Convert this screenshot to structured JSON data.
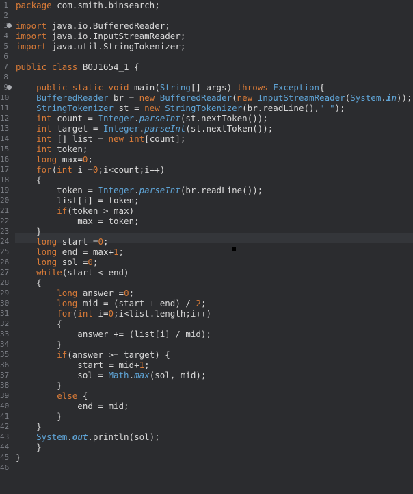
{
  "editor": {
    "language": "java",
    "cursor_line": 24,
    "lines": [
      {
        "n": "1",
        "text": "package com.smith.binsearch;"
      },
      {
        "n": "2",
        "text": ""
      },
      {
        "n": "3",
        "text": "import java.io.BufferedReader;",
        "fold": true
      },
      {
        "n": "4",
        "text": "import java.io.InputStreamReader;"
      },
      {
        "n": "5",
        "text": "import java.util.StringTokenizer;"
      },
      {
        "n": "6",
        "text": ""
      },
      {
        "n": "7",
        "text": "public class BOJ1654_1 {"
      },
      {
        "n": "8",
        "text": ""
      },
      {
        "n": "9",
        "text": "    public static void main(String[] args) throws Exception{",
        "fold": true
      },
      {
        "n": "10",
        "text": "    BufferedReader br = new BufferedReader(new InputStreamReader(System.in));"
      },
      {
        "n": "11",
        "text": "    StringTokenizer st = new StringTokenizer(br.readLine(),\" \");"
      },
      {
        "n": "12",
        "text": "    int count = Integer.parseInt(st.nextToken());"
      },
      {
        "n": "13",
        "text": "    int target = Integer.parseInt(st.nextToken());"
      },
      {
        "n": "14",
        "text": "    int [] list = new int[count];"
      },
      {
        "n": "15",
        "text": "    int token;"
      },
      {
        "n": "16",
        "text": "    long max=0;"
      },
      {
        "n": "17",
        "text": "    for(int i =0;i<count;i++)"
      },
      {
        "n": "18",
        "text": "    {"
      },
      {
        "n": "19",
        "text": "        token = Integer.parseInt(br.readLine());"
      },
      {
        "n": "20",
        "text": "        list[i] = token;"
      },
      {
        "n": "21",
        "text": "        if(token > max)"
      },
      {
        "n": "22",
        "text": "            max = token;"
      },
      {
        "n": "23",
        "text": "    }"
      },
      {
        "n": "24",
        "text": "    long start =0;"
      },
      {
        "n": "25",
        "text": "    long end = max+1;"
      },
      {
        "n": "26",
        "text": "    long sol =0;"
      },
      {
        "n": "27",
        "text": "    while(start < end)"
      },
      {
        "n": "28",
        "text": "    {"
      },
      {
        "n": "29",
        "text": "        long answer =0;"
      },
      {
        "n": "30",
        "text": "        long mid = (start + end) / 2;"
      },
      {
        "n": "31",
        "text": "        for(int i=0;i<list.length;i++)"
      },
      {
        "n": "32",
        "text": "        {"
      },
      {
        "n": "33",
        "text": "            answer += (list[i] / mid);"
      },
      {
        "n": "34",
        "text": "        }"
      },
      {
        "n": "35",
        "text": "        if(answer >= target) {"
      },
      {
        "n": "36",
        "text": "            start = mid+1;"
      },
      {
        "n": "37",
        "text": "            sol = Math.max(sol, mid);"
      },
      {
        "n": "38",
        "text": "        }"
      },
      {
        "n": "39",
        "text": "        else {"
      },
      {
        "n": "40",
        "text": "            end = mid;"
      },
      {
        "n": "41",
        "text": "        }"
      },
      {
        "n": "42",
        "text": "    }"
      },
      {
        "n": "43",
        "text": "    System.out.println(sol);"
      },
      {
        "n": "44",
        "text": "    }"
      },
      {
        "n": "45",
        "text": "}"
      },
      {
        "n": "46",
        "text": ""
      }
    ]
  },
  "colors": {
    "background": "#2b2c2f",
    "keyword": "#d97b38",
    "type": "#5fa4d6",
    "text": "#d8d8d8",
    "line_number": "#7c7f86"
  }
}
